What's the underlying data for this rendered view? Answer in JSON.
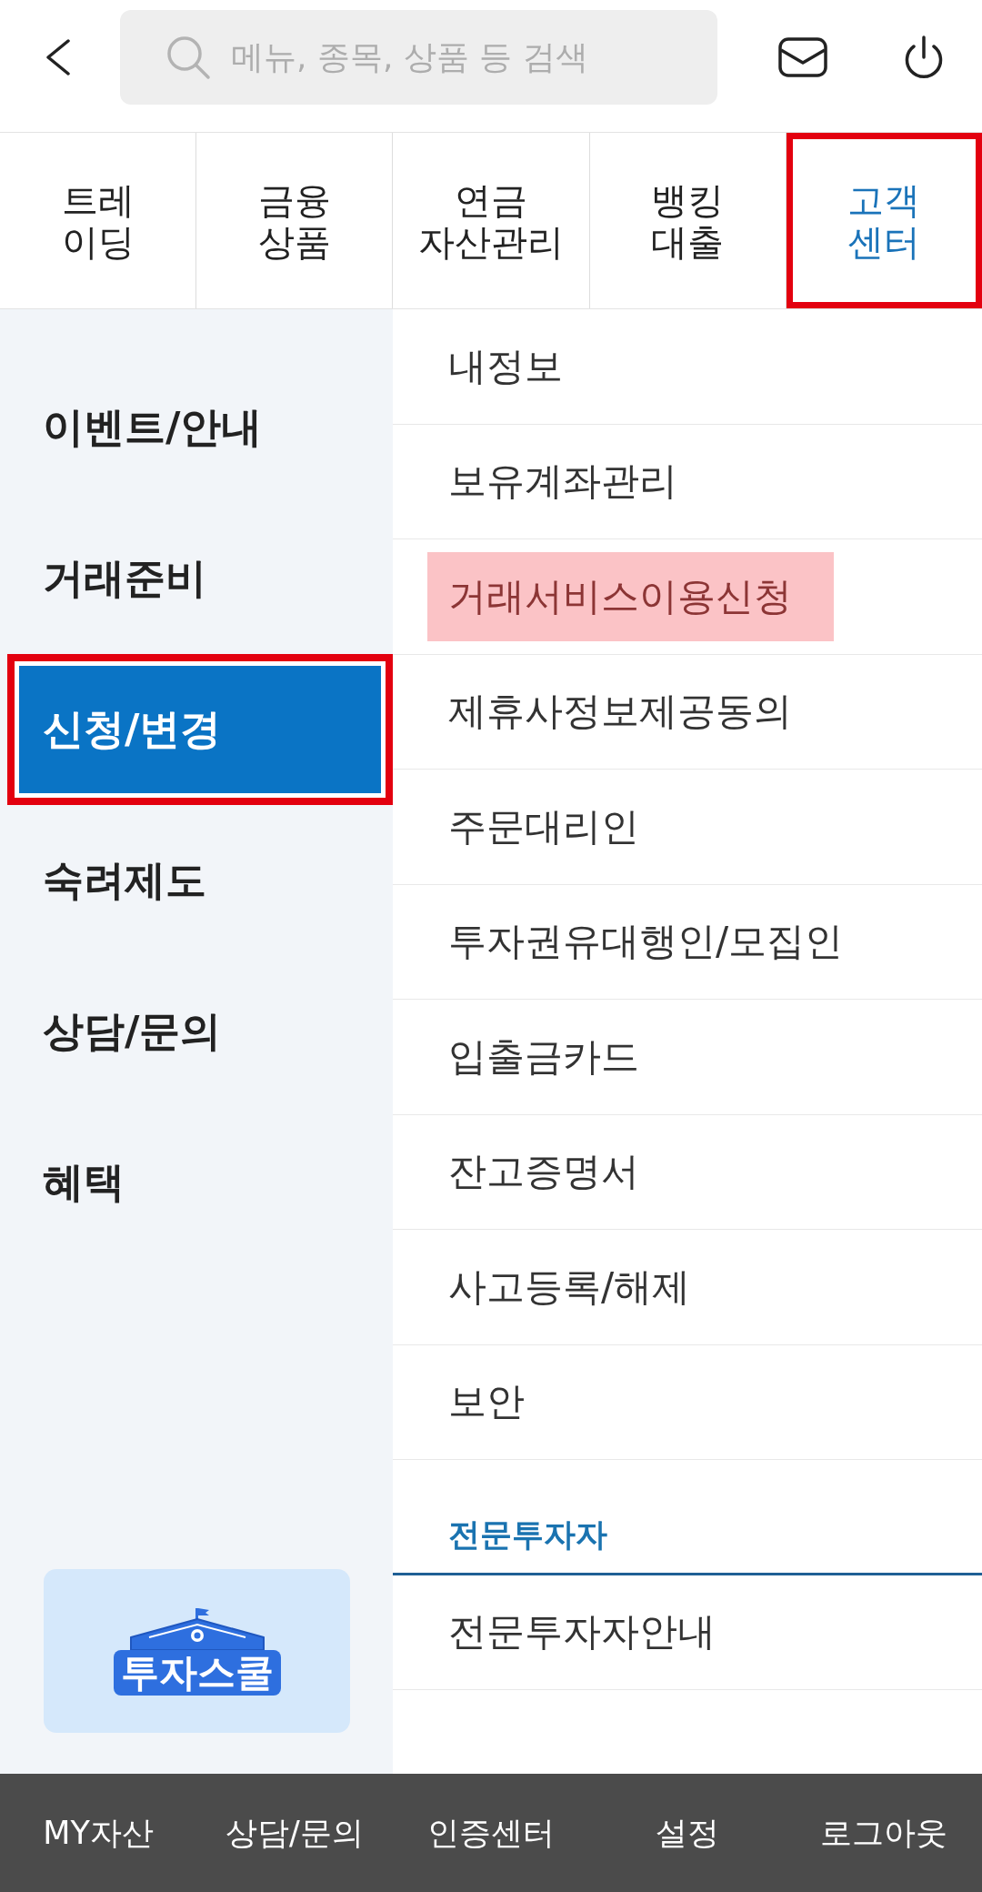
{
  "top_bar": {
    "search": {
      "placeholder": "메뉴, 종목, 상품 등 검색"
    }
  },
  "tabs": [
    {
      "label": "트레\n이딩",
      "selected": false,
      "annotated": false
    },
    {
      "label": "금융\n상품",
      "selected": false,
      "annotated": false
    },
    {
      "label": "연금\n자산관리",
      "selected": false,
      "annotated": false
    },
    {
      "label": "뱅킹\n대출",
      "selected": false,
      "annotated": false
    },
    {
      "label": "고객\n센터",
      "selected": true,
      "annotated": true
    }
  ],
  "sidebar": {
    "items": [
      {
        "label": "이벤트/안내",
        "selected": false,
        "annotated": false
      },
      {
        "label": "거래준비",
        "selected": false,
        "annotated": false
      },
      {
        "label": "신청/변경",
        "selected": true,
        "annotated": true
      },
      {
        "label": "숙려제도",
        "selected": false,
        "annotated": false
      },
      {
        "label": "상담/문의",
        "selected": false,
        "annotated": false
      },
      {
        "label": "혜택",
        "selected": false,
        "annotated": false
      }
    ],
    "banner": {
      "logo_text": "투자스쿨"
    }
  },
  "menu": {
    "items": [
      {
        "kind": "link",
        "label": "내정보",
        "highlighted": false
      },
      {
        "kind": "link",
        "label": "보유계좌관리",
        "highlighted": false
      },
      {
        "kind": "link",
        "label": "거래서비스이용신청",
        "highlighted": true
      },
      {
        "kind": "link",
        "label": "제휴사정보제공동의",
        "highlighted": false
      },
      {
        "kind": "link",
        "label": "주문대리인",
        "highlighted": false
      },
      {
        "kind": "link",
        "label": "투자권유대행인/모집인",
        "highlighted": false
      },
      {
        "kind": "link",
        "label": "입출금카드",
        "highlighted": false
      },
      {
        "kind": "link",
        "label": "잔고증명서",
        "highlighted": false
      },
      {
        "kind": "link",
        "label": "사고등록/해제",
        "highlighted": false
      },
      {
        "kind": "link",
        "label": "보안",
        "highlighted": false
      },
      {
        "kind": "section",
        "label": "전문투자자",
        "highlighted": false
      },
      {
        "kind": "link",
        "label": "전문투자자안내",
        "highlighted": false
      }
    ]
  },
  "bottom_bar": {
    "items": [
      "MY자산",
      "상담/문의",
      "인증센터",
      "설정",
      "로그아웃"
    ]
  }
}
